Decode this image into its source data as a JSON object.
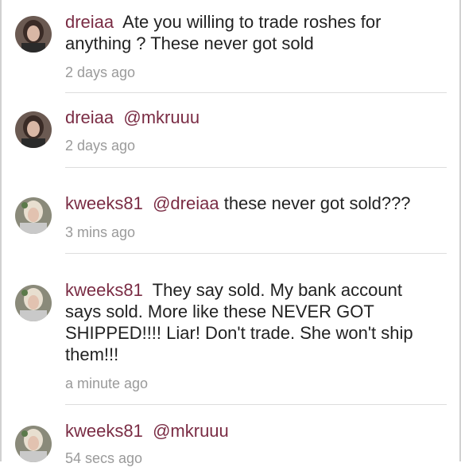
{
  "comments": [
    {
      "username": "dreiaa",
      "mention": "",
      "text": "Ate you willing to trade roshes for anything ? These never got sold",
      "time": "2 days ago",
      "avatar": "user-avatar-dreiaa"
    },
    {
      "username": "dreiaa",
      "mention": "@mkruuu",
      "text": "",
      "time": "2 days ago",
      "avatar": "user-avatar-dreiaa"
    },
    {
      "username": "kweeks81",
      "mention": "@dreiaa",
      "text": "these never got sold???",
      "time": "3 mins ago",
      "avatar": "user-avatar-kweeks81"
    },
    {
      "username": "kweeks81",
      "mention": "",
      "text": "They say sold. My bank account says sold. More like these NEVER GOT SHIPPED!!!! Liar! Don't trade. She won't ship them!!!",
      "time": "a minute ago",
      "avatar": "user-avatar-kweeks81"
    },
    {
      "username": "kweeks81",
      "mention": "@mkruuu",
      "text": "",
      "time": "54 secs ago",
      "avatar": "user-avatar-kweeks81"
    }
  ]
}
